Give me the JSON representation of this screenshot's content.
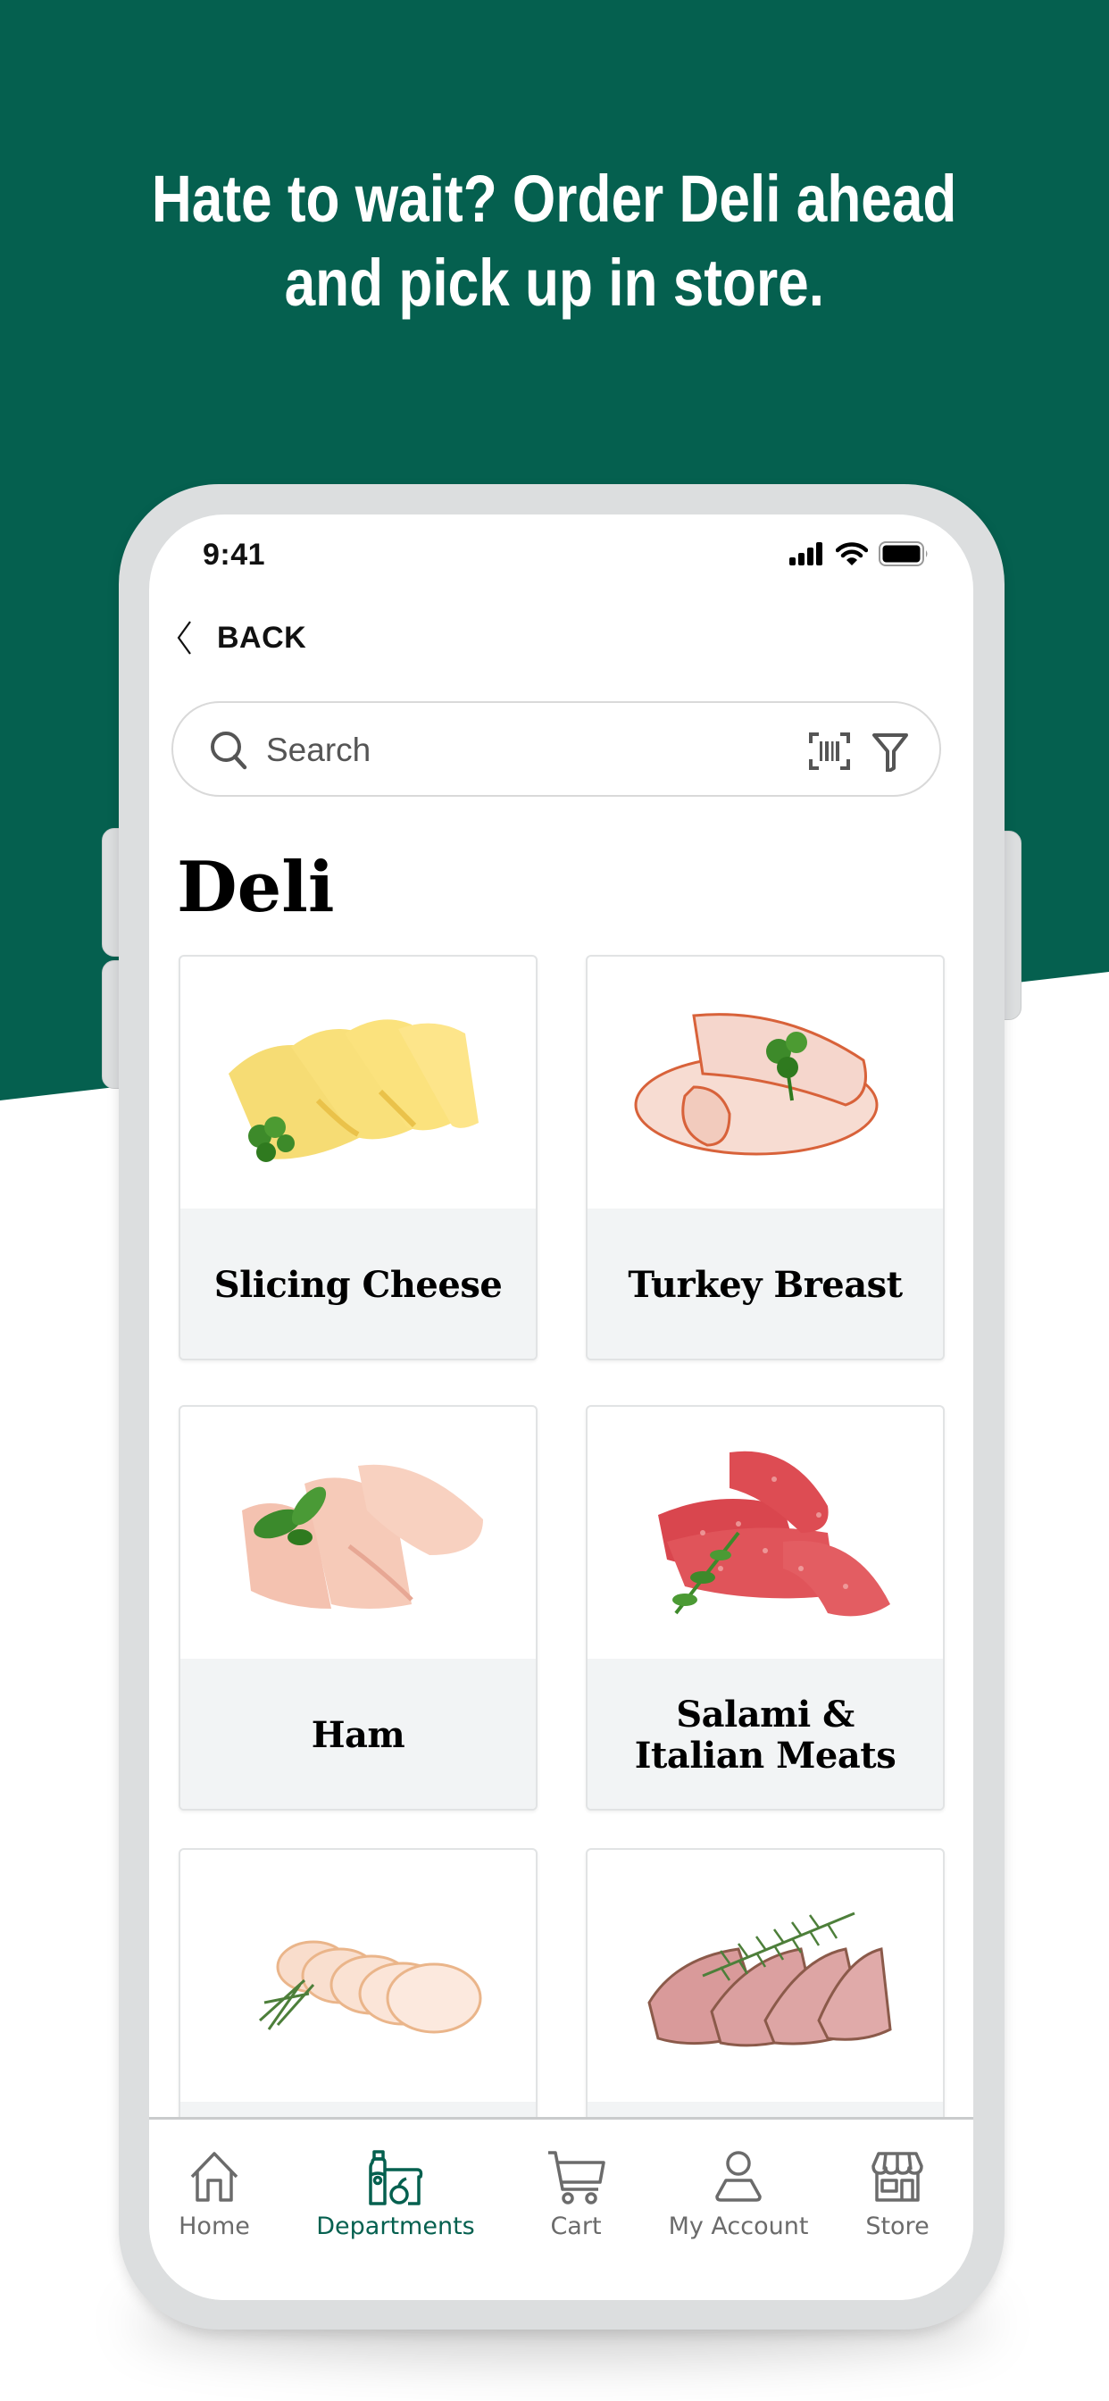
{
  "promo": {
    "headline_line1": "Hate to wait? Order Deli ahead",
    "headline_line2": "and pick up in store."
  },
  "colors": {
    "brand_green": "#05604f",
    "frame_gray": "#dcdedf",
    "label_bg": "#f2f4f5",
    "icon_gray": "#6b6b6b"
  },
  "status_bar": {
    "time": "9:41",
    "icons": [
      "cellular-signal-icon",
      "wifi-icon",
      "battery-icon"
    ]
  },
  "nav": {
    "back_label": "BACK",
    "back_icon": "chevron-left-icon"
  },
  "search": {
    "placeholder": "Search",
    "value": "",
    "icons": [
      "search-icon",
      "barcode-scan-icon",
      "filter-icon"
    ]
  },
  "page": {
    "title": "Deli"
  },
  "categories": [
    {
      "label": "Slicing Cheese",
      "image": "sliced cheese with parsley"
    },
    {
      "label": "Turkey Breast",
      "image": "rolled turkey slices with cilantro"
    },
    {
      "label": "Ham",
      "image": "folded ham slices with basil"
    },
    {
      "label": "Salami & Italian Meats",
      "image": "salami slices with arugula"
    },
    {
      "label": "",
      "image": "sliced chicken breast with rosemary"
    },
    {
      "label": "",
      "image": "sliced roast beef with rosemary"
    }
  ],
  "tabbar": {
    "active": "Departments",
    "items": [
      {
        "label": "Home",
        "icon": "home-icon"
      },
      {
        "label": "Departments",
        "icon": "departments-icon"
      },
      {
        "label": "Cart",
        "icon": "cart-icon"
      },
      {
        "label": "My Account",
        "icon": "account-icon"
      },
      {
        "label": "Store",
        "icon": "store-icon"
      }
    ]
  }
}
